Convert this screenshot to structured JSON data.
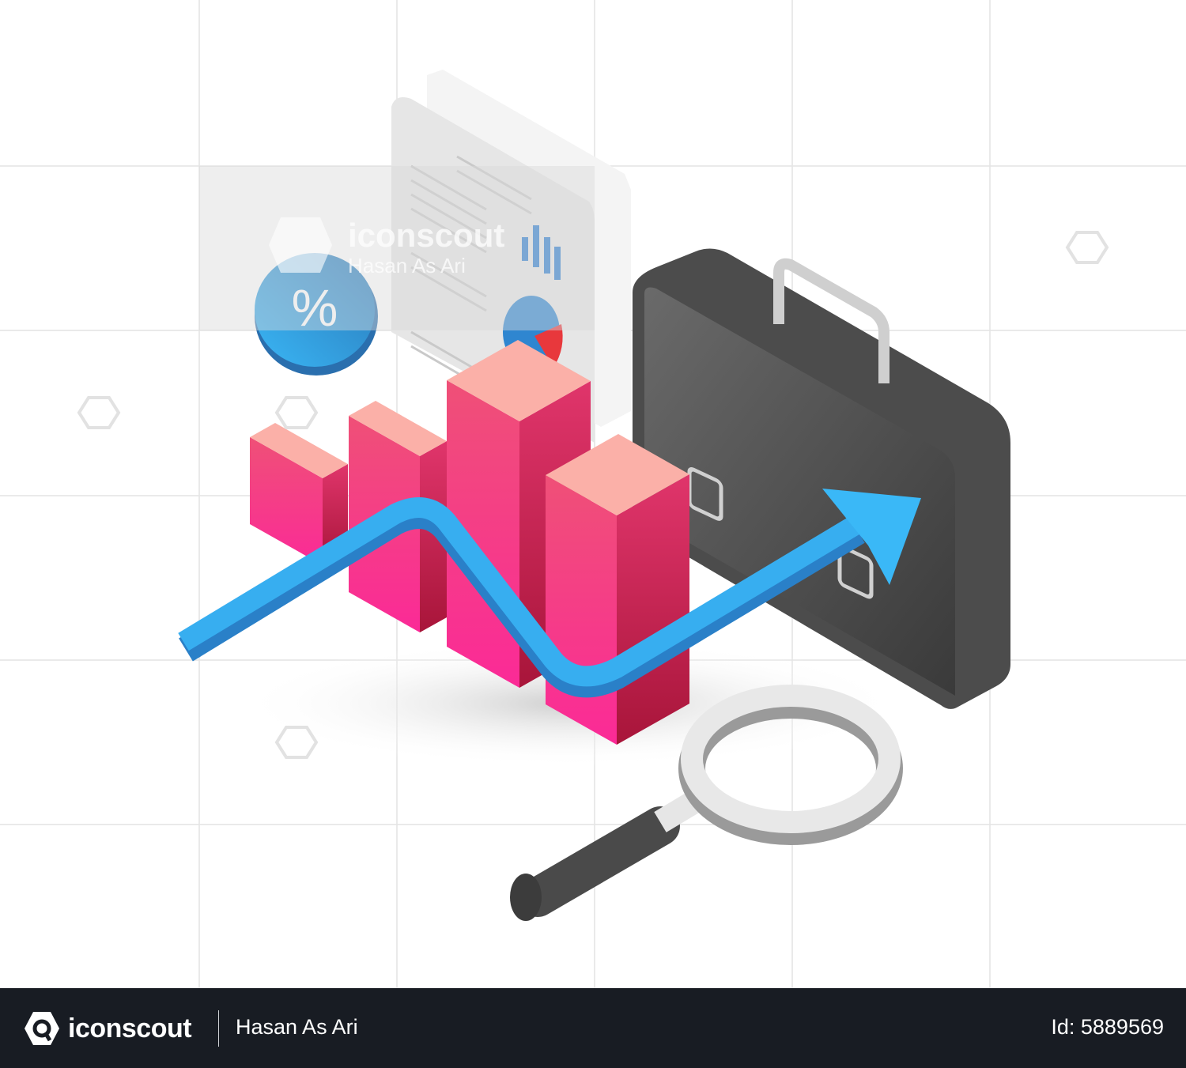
{
  "illustration": {
    "percent_symbol": "%",
    "colors": {
      "bar_pink": "#f72c8f",
      "bar_top": "#fbb0a8",
      "arrow_blue": "#35a8ee",
      "briefcase": "#555555",
      "document": "#eeeeee"
    }
  },
  "watermark": {
    "brand": "iconscout",
    "author": "Hasan As Ari"
  },
  "footer": {
    "brand": "iconscout",
    "author": "Hasan As Ari",
    "asset_id": "Id: 5889569"
  }
}
